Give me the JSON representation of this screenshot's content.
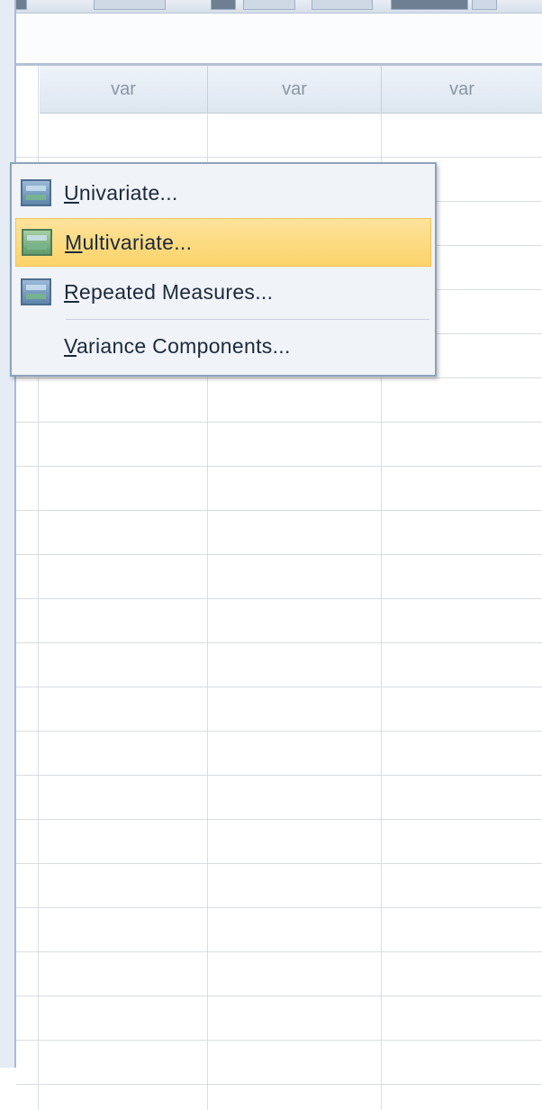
{
  "grid": {
    "columns": [
      {
        "label": "var"
      },
      {
        "label": "var"
      },
      {
        "label": "var"
      }
    ]
  },
  "menu": {
    "items": [
      {
        "mnemonic": "U",
        "rest": "nivariate...",
        "icon": "univariate-icon",
        "highlighted": false
      },
      {
        "mnemonic": "M",
        "rest": "ultivariate...",
        "icon": "multivariate-icon",
        "highlighted": true
      },
      {
        "mnemonic": "R",
        "rest": "epeated Measures...",
        "icon": "repeated-measures-icon",
        "highlighted": false
      },
      {
        "mnemonic": "V",
        "rest": "ariance Components...",
        "icon": null,
        "highlighted": false
      }
    ]
  },
  "colors": {
    "highlight": "#fbd36a",
    "menu_bg": "#f0f3f8",
    "grid_line": "#d9dde2",
    "header_text": "#8a96a6"
  }
}
